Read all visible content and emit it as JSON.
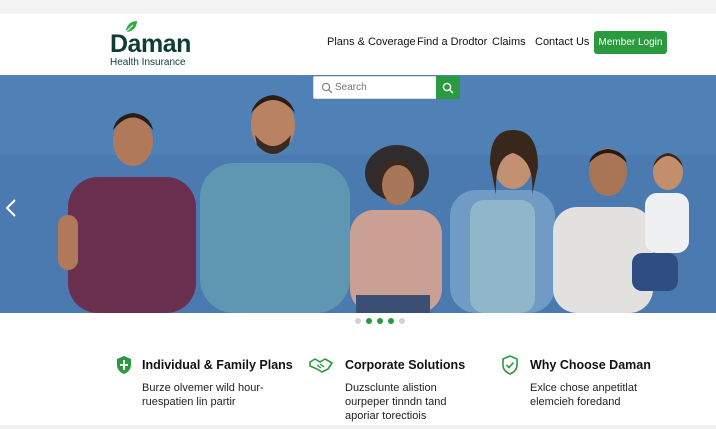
{
  "brand": {
    "name": "Daman",
    "tagline": "Health Insurance",
    "leaf_color": "#3aa64a",
    "text_color": "#0f3d33"
  },
  "nav": {
    "items": [
      "Plans & Coverage",
      "Find a Drodtor",
      "Claims",
      "Contact Us"
    ],
    "login_label": "Member Login"
  },
  "search": {
    "placeholder": "Search",
    "button_icon": "search-icon"
  },
  "hero": {
    "background_color": "#4a7ab0",
    "prev_icon": "chevron-left-icon",
    "slides_count": 5,
    "active_slide": 3
  },
  "features": [
    {
      "icon": "shield-icon",
      "title": "Individual & Family Plans",
      "lines": [
        "Burze olvemer wild hour-",
        "ruespatien lin partir"
      ]
    },
    {
      "icon": "handshake-icon",
      "title": "Corporate Solutions",
      "lines": [
        "Duzsclunte alistion",
        "ourpeper tinndn tand",
        "aporiar torectiois"
      ]
    },
    {
      "icon": "shield-check-icon",
      "title": "Why Choose Daman",
      "lines": [
        "Exlce chose anpetitlat",
        "elemcieh foredand"
      ]
    }
  ],
  "colors": {
    "accent": "#2a9a3f"
  }
}
